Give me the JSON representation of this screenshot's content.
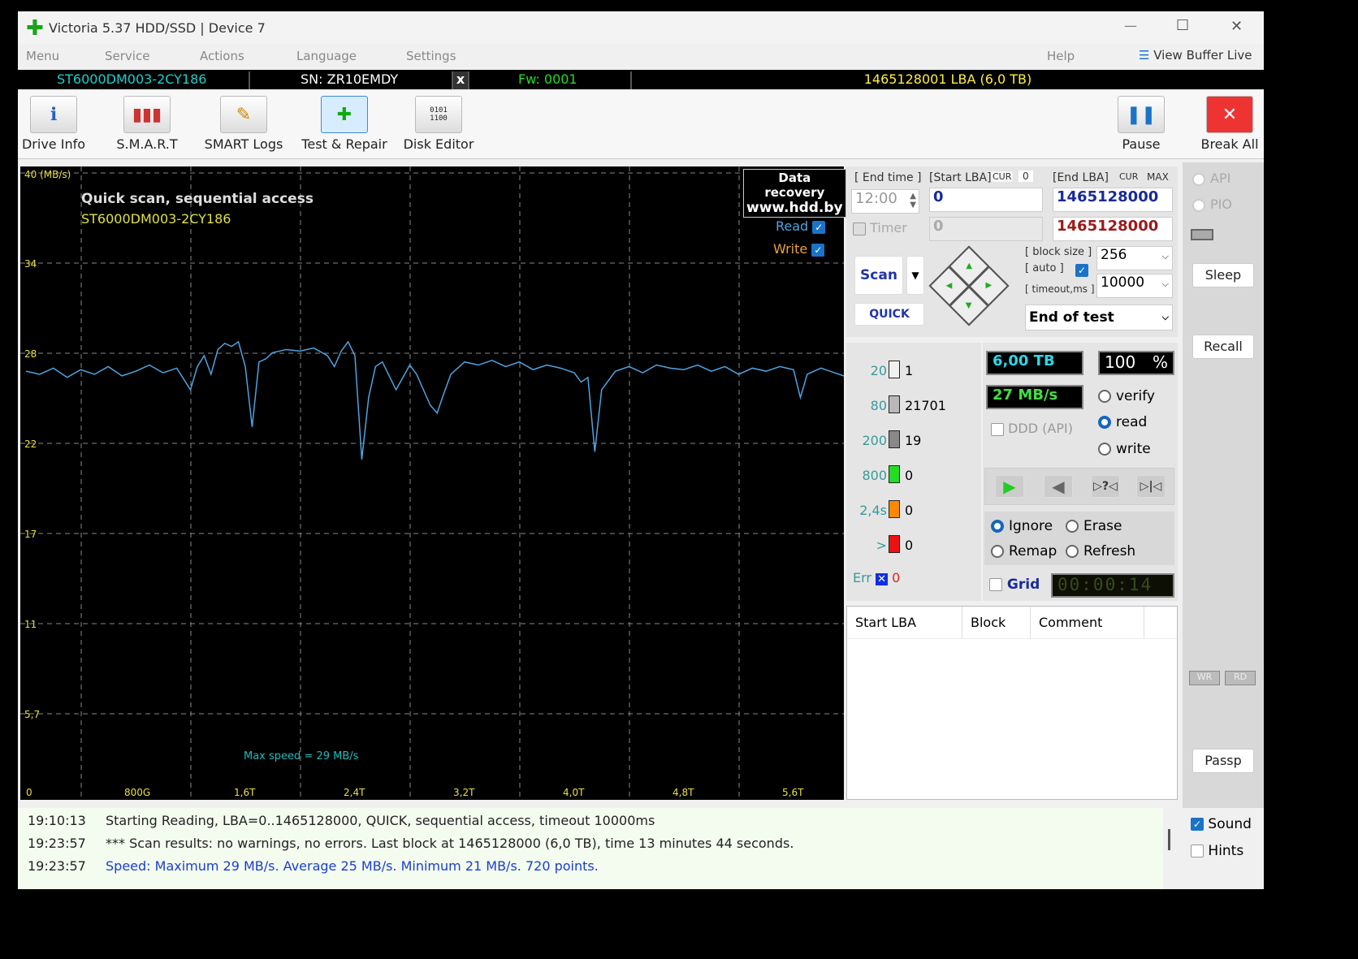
{
  "window": {
    "title": "Victoria 5.37 HDD/SSD | Device 7",
    "min": "—",
    "max": "☐",
    "close": "✕"
  },
  "menu": {
    "items": [
      "Menu",
      "Service",
      "Actions",
      "Language",
      "Settings"
    ],
    "help": "Help",
    "view_buffer": "View Buffer Live"
  },
  "infobar": {
    "model": "ST6000DM003-2CY186",
    "serial": "SN: ZR10EMDY",
    "close": "x",
    "firmware": "Fw: 0001",
    "capacity": "1465128001 LBA (6,0 TB)"
  },
  "toolbar": {
    "items": [
      {
        "label": "Drive Info",
        "icon": "info-icon"
      },
      {
        "label": "S.M.A.R.T",
        "icon": "smart-icon"
      },
      {
        "label": "SMART Logs",
        "icon": "logs-icon"
      },
      {
        "label": "Test & Repair",
        "icon": "test-repair-icon"
      },
      {
        "label": "Disk Editor",
        "icon": "binary-icon"
      }
    ],
    "pause": "Pause",
    "break_all": "Break All"
  },
  "graph": {
    "title": "Quick scan, sequential access",
    "model": "ST6000DM003-2CY186",
    "watermark1": "Data recovery",
    "watermark2": "www.hdd.by",
    "read": "Read",
    "write": "Write",
    "max_speed": "Max speed = 29 MB/s",
    "read_color": "#4fa3e0"
  },
  "chart_data": {
    "type": "line",
    "ylabel": "(MB/s)",
    "ylim": [
      0,
      40
    ],
    "xlim_tb": [
      0,
      6.0
    ],
    "y_ticks": [
      "40",
      "34",
      "28",
      "22",
      "17",
      "11",
      "5,7",
      "0"
    ],
    "x_ticks": [
      "0",
      "800G",
      "1,6T",
      "2,4T",
      "3,2T",
      "4,0T",
      "4,8T",
      "5,6T"
    ],
    "grid": true,
    "series": [
      {
        "name": "Read",
        "x": [
          0,
          0.1,
          0.2,
          0.3,
          0.4,
          0.5,
          0.6,
          0.7,
          0.8,
          0.9,
          1.0,
          1.1,
          1.2,
          1.25,
          1.3,
          1.35,
          1.4,
          1.45,
          1.5,
          1.55,
          1.6,
          1.65,
          1.7,
          1.75,
          1.8,
          1.9,
          2.0,
          2.1,
          2.2,
          2.25,
          2.3,
          2.35,
          2.4,
          2.45,
          2.5,
          2.55,
          2.6,
          2.7,
          2.8,
          2.85,
          2.95,
          3.0,
          3.05,
          3.1,
          3.2,
          3.3,
          3.4,
          3.5,
          3.6,
          3.7,
          3.8,
          3.9,
          4.0,
          4.05,
          4.1,
          4.15,
          4.2,
          4.3,
          4.4,
          4.5,
          4.6,
          4.7,
          4.8,
          4.9,
          5.0,
          5.1,
          5.2,
          5.3,
          5.4,
          5.5,
          5.6,
          5.65,
          5.7,
          5.8,
          5.9,
          6.0
        ],
        "y": [
          27.2,
          27.0,
          27.4,
          26.8,
          27.3,
          27.0,
          27.5,
          26.9,
          27.2,
          27.6,
          27.1,
          27.4,
          26.0,
          27.5,
          28.2,
          27.0,
          28.6,
          29.0,
          28.8,
          29.1,
          27.5,
          23.6,
          27.8,
          28.0,
          28.4,
          28.6,
          28.5,
          28.7,
          28.2,
          27.5,
          28.5,
          29.1,
          28.2,
          21.5,
          25.5,
          27.5,
          27.8,
          26.0,
          27.6,
          27.0,
          25.0,
          24.5,
          25.8,
          27.0,
          27.8,
          27.6,
          27.9,
          27.5,
          27.8,
          27.3,
          27.6,
          27.4,
          27.1,
          26.5,
          26.8,
          22.0,
          26.0,
          27.2,
          27.5,
          27.1,
          27.6,
          27.4,
          27.3,
          27.6,
          27.2,
          27.5,
          27.0,
          27.4,
          27.2,
          27.5,
          27.3,
          25.5,
          27.0,
          27.4,
          27.1,
          26.8
        ]
      }
    ]
  },
  "controls": {
    "end_time_label": "[ End time ]",
    "end_time": "12:00",
    "start_lba_label": "[Start LBA]",
    "cur": "CUR",
    "cur_value": "0",
    "end_lba_label": "[End LBA]",
    "max": "MAX",
    "start_lba": "0",
    "end_lba": "1465128000",
    "timer_label": "Timer",
    "timer_value": "0",
    "end_lba2": "1465128000",
    "block_size_label": "[ block size ]",
    "auto_label": "[ auto ]",
    "timeout_label": "[ timeout,ms ]",
    "block_size": "256",
    "timeout": "10000",
    "scan": "Scan",
    "quick": "QUICK",
    "end_action": "End of test"
  },
  "histogram": [
    {
      "label": "20",
      "count": "1",
      "color": "#f0f0f0"
    },
    {
      "label": "80",
      "count": "21701",
      "color": "#b8b8b8"
    },
    {
      "label": "200",
      "count": "19",
      "color": "#888888"
    },
    {
      "label": "800",
      "count": "0",
      "color": "#22dd22"
    },
    {
      "label": "2,4s",
      "count": "0",
      "color": "#ff8800"
    },
    {
      "label": ">",
      "count": "0",
      "color": "#ee1111"
    }
  ],
  "err": {
    "label": "Err",
    "count": "0"
  },
  "status": {
    "size": "6,00 TB",
    "percent": "100",
    "percent_sign": "%",
    "speed": "27 MB/s",
    "ddd": "DDD (API)",
    "verify": "verify",
    "read": "read",
    "write": "write",
    "ignore": "Ignore",
    "erase": "Erase",
    "remap": "Remap",
    "refresh": "Refresh",
    "grid": "Grid",
    "timer": "00:00:14"
  },
  "table": {
    "headers": [
      "Start LBA",
      "Block",
      "Comment"
    ]
  },
  "side": {
    "api": "API",
    "pio": "PIO",
    "sleep": "Sleep",
    "recall": "Recall",
    "wr": "WR",
    "rd": "RD",
    "passp": "Passp",
    "sound": "Sound",
    "hints": "Hints"
  },
  "log": [
    {
      "time": "19:10:13",
      "text": "Starting Reading, LBA=0..1465128000, QUICK, sequential access, timeout 10000ms",
      "color": "#222"
    },
    {
      "time": "19:23:57",
      "text": "*** Scan results: no warnings, no errors. Last block at 1465128000 (6,0 TB), time 13 minutes 44 seconds.",
      "color": "#222"
    },
    {
      "time": "19:23:57",
      "text": "Speed: Maximum 29 MB/s. Average 25 MB/s. Minimum 21 MB/s. 720 points.",
      "color": "#1a3fcf"
    }
  ]
}
